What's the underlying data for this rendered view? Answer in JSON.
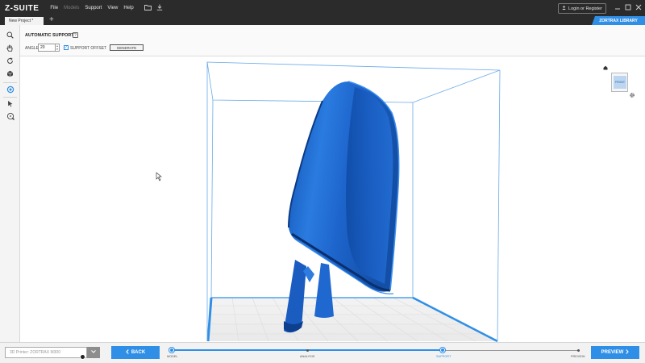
{
  "app": {
    "logo": "Z-SUITE",
    "menu": [
      {
        "label": "File",
        "enabled": true
      },
      {
        "label": "Models",
        "enabled": false
      },
      {
        "label": "Support",
        "enabled": true
      },
      {
        "label": "View",
        "enabled": true
      },
      {
        "label": "Help",
        "enabled": true
      }
    ],
    "toolbar_icons": [
      "open-folder-icon",
      "download-icon"
    ],
    "login_label": "Login or Register",
    "window_controls": [
      "minimize-icon",
      "maximize-icon",
      "close-icon"
    ]
  },
  "tabs": {
    "items": [
      {
        "label": "New Project *"
      }
    ],
    "add_label": "+",
    "library_label": "ZORTRAX LIBRARY"
  },
  "left_tools": [
    {
      "name": "zoom-tool",
      "icon": "magnifier-icon",
      "glyph": "⌕",
      "active": false
    },
    {
      "name": "pan-tool",
      "icon": "hand-icon",
      "glyph": "✋",
      "active": false
    },
    {
      "name": "rotate-tool",
      "icon": "rotate-icon",
      "glyph": "⟳",
      "active": false
    },
    {
      "name": "view-tool",
      "icon": "cube-icon",
      "glyph": "◈",
      "active": false
    },
    {
      "name": "support-tool",
      "icon": "support-icon",
      "glyph": "◉",
      "active": true
    },
    {
      "name": "select-tool",
      "icon": "cursor-icon",
      "glyph": "➤",
      "active": false
    },
    {
      "name": "add-support-tool",
      "icon": "add-point-icon",
      "glyph": "⊕",
      "active": false
    }
  ],
  "options": {
    "title": "AUTOMATIC SUPPORT",
    "help_glyph": "?",
    "angle_label": "ANGLE",
    "angle_value": "20",
    "support_offset_label": "SUPPORT OFFSET",
    "support_offset_checked": true,
    "generate_label": "GENERATE"
  },
  "viewcube": {
    "face_label": "FRONT"
  },
  "bottom": {
    "printer_placeholder": "3D Printer: ZORTRAX M300",
    "back_label": "BACK",
    "preview_label": "PREVIEW",
    "steps": [
      {
        "label": "MODEL",
        "state": "done"
      },
      {
        "label": "ANALYSIS",
        "state": "pending"
      },
      {
        "label": "SUPPORT",
        "state": "current"
      },
      {
        "label": "PREVIEW",
        "state": "pending"
      }
    ],
    "progress_fraction": 0.66
  },
  "colors": {
    "accent": "#2f8fe6",
    "menubar": "#2b2b2b",
    "model": "#1f66c9",
    "bed_grid": "#d6d6d6",
    "frame": "#6aaae8"
  }
}
